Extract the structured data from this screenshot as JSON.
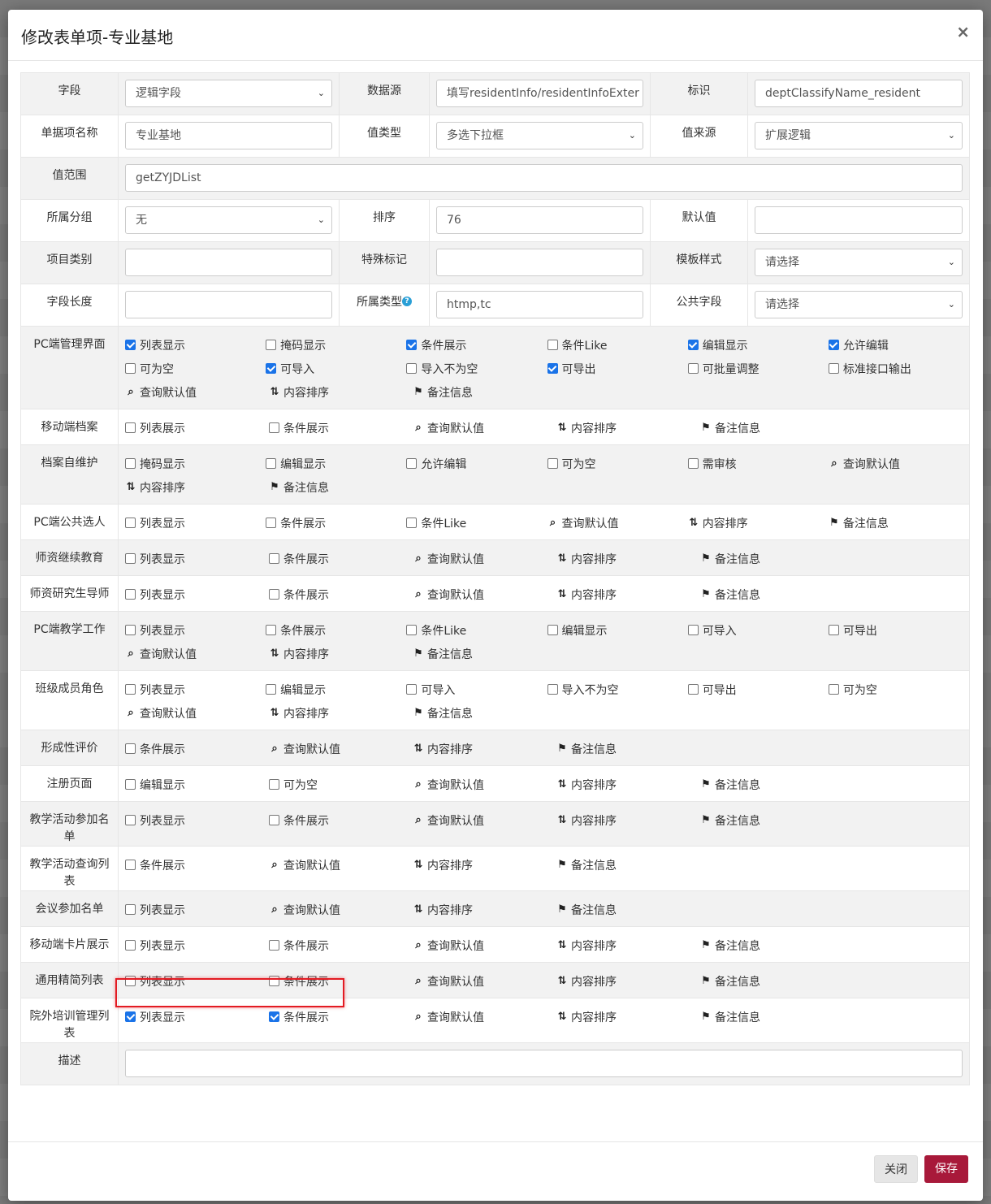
{
  "modal": {
    "title": "修改表单项-专业基地",
    "close_glyph": "×",
    "footer": {
      "close_label": "关闭",
      "save_label": "保存"
    }
  },
  "fields": {
    "field_label": "字段",
    "field_value": "逻辑字段",
    "datasource_label": "数据源",
    "datasource_placeholder": "填写residentInfo/residentInfoExter",
    "identifier_label": "标识",
    "identifier_value": "deptClassifyName_resident",
    "name_label": "单据项名称",
    "name_value": "专业基地",
    "valuetype_label": "值类型",
    "valuetype_value": "多选下拉框",
    "valuesource_label": "值来源",
    "valuesource_value": "扩展逻辑",
    "range_label": "值范围",
    "range_value": "getZYJDList",
    "group_label": "所属分组",
    "group_value": "无",
    "sort_label": "排序",
    "sort_value": "76",
    "default_label": "默认值",
    "default_value": "",
    "category_label": "项目类别",
    "category_value": "",
    "special_label": "特殊标记",
    "special_value": "",
    "template_label": "模板样式",
    "template_value": "请选择",
    "length_label": "字段长度",
    "length_value": "",
    "belong_label": "所属类型",
    "belong_value": "htmp,tc",
    "public_label": "公共字段",
    "public_value": "请选择",
    "desc_label": "描述",
    "desc_value": ""
  },
  "icons": {
    "search": "search-icon",
    "sort": "sort-icon",
    "tag": "tag-icon",
    "help": "help-icon"
  },
  "sections": [
    {
      "label": "PC端管理界面",
      "rows": [
        [
          {
            "t": "cb",
            "text": "列表显示",
            "checked": true
          },
          {
            "t": "cb",
            "text": "掩码显示",
            "checked": false
          },
          {
            "t": "cb",
            "text": "条件展示",
            "checked": true
          },
          {
            "t": "cb",
            "text": "条件Like",
            "checked": false
          },
          {
            "t": "cb",
            "text": "编辑显示",
            "checked": true
          },
          {
            "t": "cb",
            "text": "允许编辑",
            "checked": true
          }
        ],
        [
          {
            "t": "cb",
            "text": "可为空",
            "checked": false
          },
          {
            "t": "cb",
            "text": "可导入",
            "checked": true
          },
          {
            "t": "cb",
            "text": "导入不为空",
            "checked": false
          },
          {
            "t": "cb",
            "text": "可导出",
            "checked": true
          },
          {
            "t": "cb",
            "text": "可批量调整",
            "checked": false
          },
          {
            "t": "cb",
            "text": "标准接口输出",
            "checked": false
          }
        ],
        [
          {
            "t": "search",
            "text": "查询默认值"
          },
          {
            "t": "sort",
            "text": "内容排序"
          },
          {
            "t": "tag",
            "text": "备注信息"
          }
        ]
      ]
    },
    {
      "label": "移动端档案",
      "rows": [
        [
          {
            "t": "cb",
            "text": "列表展示",
            "checked": false
          },
          {
            "t": "cb",
            "text": "条件展示",
            "checked": false
          },
          {
            "t": "search",
            "text": "查询默认值"
          },
          {
            "t": "sort",
            "text": "内容排序"
          },
          {
            "t": "tag",
            "text": "备注信息"
          }
        ]
      ]
    },
    {
      "label": "档案自维护",
      "rows": [
        [
          {
            "t": "cb",
            "text": "掩码显示",
            "checked": false
          },
          {
            "t": "cb",
            "text": "编辑显示",
            "checked": false
          },
          {
            "t": "cb",
            "text": "允许编辑",
            "checked": false
          },
          {
            "t": "cb",
            "text": "可为空",
            "checked": false
          },
          {
            "t": "cb",
            "text": "需审核",
            "checked": false
          },
          {
            "t": "search",
            "text": "查询默认值"
          }
        ],
        [
          {
            "t": "sort",
            "text": "内容排序"
          },
          {
            "t": "tag",
            "text": "备注信息"
          }
        ]
      ]
    },
    {
      "label": "PC端公共选人",
      "rows": [
        [
          {
            "t": "cb",
            "text": "列表显示",
            "checked": false
          },
          {
            "t": "cb",
            "text": "条件展示",
            "checked": false
          },
          {
            "t": "cb",
            "text": "条件Like",
            "checked": false
          },
          {
            "t": "search",
            "text": "查询默认值"
          },
          {
            "t": "sort",
            "text": "内容排序"
          },
          {
            "t": "tag",
            "text": "备注信息"
          }
        ]
      ]
    },
    {
      "label": "师资继续教育",
      "rows": [
        [
          {
            "t": "cb",
            "text": "列表显示",
            "checked": false
          },
          {
            "t": "cb",
            "text": "条件展示",
            "checked": false
          },
          {
            "t": "search",
            "text": "查询默认值"
          },
          {
            "t": "sort",
            "text": "内容排序"
          },
          {
            "t": "tag",
            "text": "备注信息"
          }
        ]
      ]
    },
    {
      "label": "师资研究生导师",
      "rows": [
        [
          {
            "t": "cb",
            "text": "列表显示",
            "checked": false
          },
          {
            "t": "cb",
            "text": "条件展示",
            "checked": false
          },
          {
            "t": "search",
            "text": "查询默认值"
          },
          {
            "t": "sort",
            "text": "内容排序"
          },
          {
            "t": "tag",
            "text": "备注信息"
          }
        ]
      ]
    },
    {
      "label": "PC端教学工作",
      "rows": [
        [
          {
            "t": "cb",
            "text": "列表显示",
            "checked": false
          },
          {
            "t": "cb",
            "text": "条件展示",
            "checked": false
          },
          {
            "t": "cb",
            "text": "条件Like",
            "checked": false
          },
          {
            "t": "cb",
            "text": "编辑显示",
            "checked": false
          },
          {
            "t": "cb",
            "text": "可导入",
            "checked": false
          },
          {
            "t": "cb",
            "text": "可导出",
            "checked": false
          }
        ],
        [
          {
            "t": "search",
            "text": "查询默认值"
          },
          {
            "t": "sort",
            "text": "内容排序"
          },
          {
            "t": "tag",
            "text": "备注信息"
          }
        ]
      ]
    },
    {
      "label": "班级成员角色",
      "rows": [
        [
          {
            "t": "cb",
            "text": "列表显示",
            "checked": false
          },
          {
            "t": "cb",
            "text": "编辑显示",
            "checked": false
          },
          {
            "t": "cb",
            "text": "可导入",
            "checked": false
          },
          {
            "t": "cb",
            "text": "导入不为空",
            "checked": false
          },
          {
            "t": "cb",
            "text": "可导出",
            "checked": false
          },
          {
            "t": "cb",
            "text": "可为空",
            "checked": false
          }
        ],
        [
          {
            "t": "search",
            "text": "查询默认值"
          },
          {
            "t": "sort",
            "text": "内容排序"
          },
          {
            "t": "tag",
            "text": "备注信息"
          }
        ]
      ]
    },
    {
      "label": "形成性评价",
      "rows": [
        [
          {
            "t": "cb",
            "text": "条件展示",
            "checked": false
          },
          {
            "t": "search",
            "text": "查询默认值"
          },
          {
            "t": "sort",
            "text": "内容排序"
          },
          {
            "t": "tag",
            "text": "备注信息"
          }
        ]
      ]
    },
    {
      "label": "注册页面",
      "rows": [
        [
          {
            "t": "cb",
            "text": "编辑显示",
            "checked": false
          },
          {
            "t": "cb",
            "text": "可为空",
            "checked": false
          },
          {
            "t": "search",
            "text": "查询默认值"
          },
          {
            "t": "sort",
            "text": "内容排序"
          },
          {
            "t": "tag",
            "text": "备注信息"
          }
        ]
      ]
    },
    {
      "label": "教学活动参加名单",
      "rows": [
        [
          {
            "t": "cb",
            "text": "列表显示",
            "checked": false
          },
          {
            "t": "cb",
            "text": "条件展示",
            "checked": false
          },
          {
            "t": "search",
            "text": "查询默认值"
          },
          {
            "t": "sort",
            "text": "内容排序"
          },
          {
            "t": "tag",
            "text": "备注信息"
          }
        ]
      ]
    },
    {
      "label": "教学活动查询列表",
      "rows": [
        [
          {
            "t": "cb",
            "text": "条件展示",
            "checked": false
          },
          {
            "t": "search",
            "text": "查询默认值"
          },
          {
            "t": "sort",
            "text": "内容排序"
          },
          {
            "t": "tag",
            "text": "备注信息"
          }
        ]
      ]
    },
    {
      "label": "会议参加名单",
      "rows": [
        [
          {
            "t": "cb",
            "text": "列表显示",
            "checked": false
          },
          {
            "t": "search",
            "text": "查询默认值"
          },
          {
            "t": "sort",
            "text": "内容排序"
          },
          {
            "t": "tag",
            "text": "备注信息"
          }
        ]
      ]
    },
    {
      "label": "移动端卡片展示",
      "rows": [
        [
          {
            "t": "cb",
            "text": "列表显示",
            "checked": false
          },
          {
            "t": "cb",
            "text": "条件展示",
            "checked": false
          },
          {
            "t": "search",
            "text": "查询默认值"
          },
          {
            "t": "sort",
            "text": "内容排序"
          },
          {
            "t": "tag",
            "text": "备注信息"
          }
        ]
      ]
    },
    {
      "label": "通用精简列表",
      "rows": [
        [
          {
            "t": "cb",
            "text": "列表显示",
            "checked": false
          },
          {
            "t": "cb",
            "text": "条件展示",
            "checked": false
          },
          {
            "t": "search",
            "text": "查询默认值"
          },
          {
            "t": "sort",
            "text": "内容排序"
          },
          {
            "t": "tag",
            "text": "备注信息"
          }
        ]
      ]
    },
    {
      "label": "院外培训管理列表",
      "rows": [
        [
          {
            "t": "cb",
            "text": "列表显示",
            "checked": true
          },
          {
            "t": "cb",
            "text": "条件展示",
            "checked": true
          },
          {
            "t": "search",
            "text": "查询默认值"
          },
          {
            "t": "sort",
            "text": "内容排序"
          },
          {
            "t": "tag",
            "text": "备注信息"
          }
        ]
      ]
    }
  ],
  "colors": {
    "save_button": "#a8193a",
    "checkbox_checked": "#1a73e8",
    "highlight": "#e31b23"
  }
}
